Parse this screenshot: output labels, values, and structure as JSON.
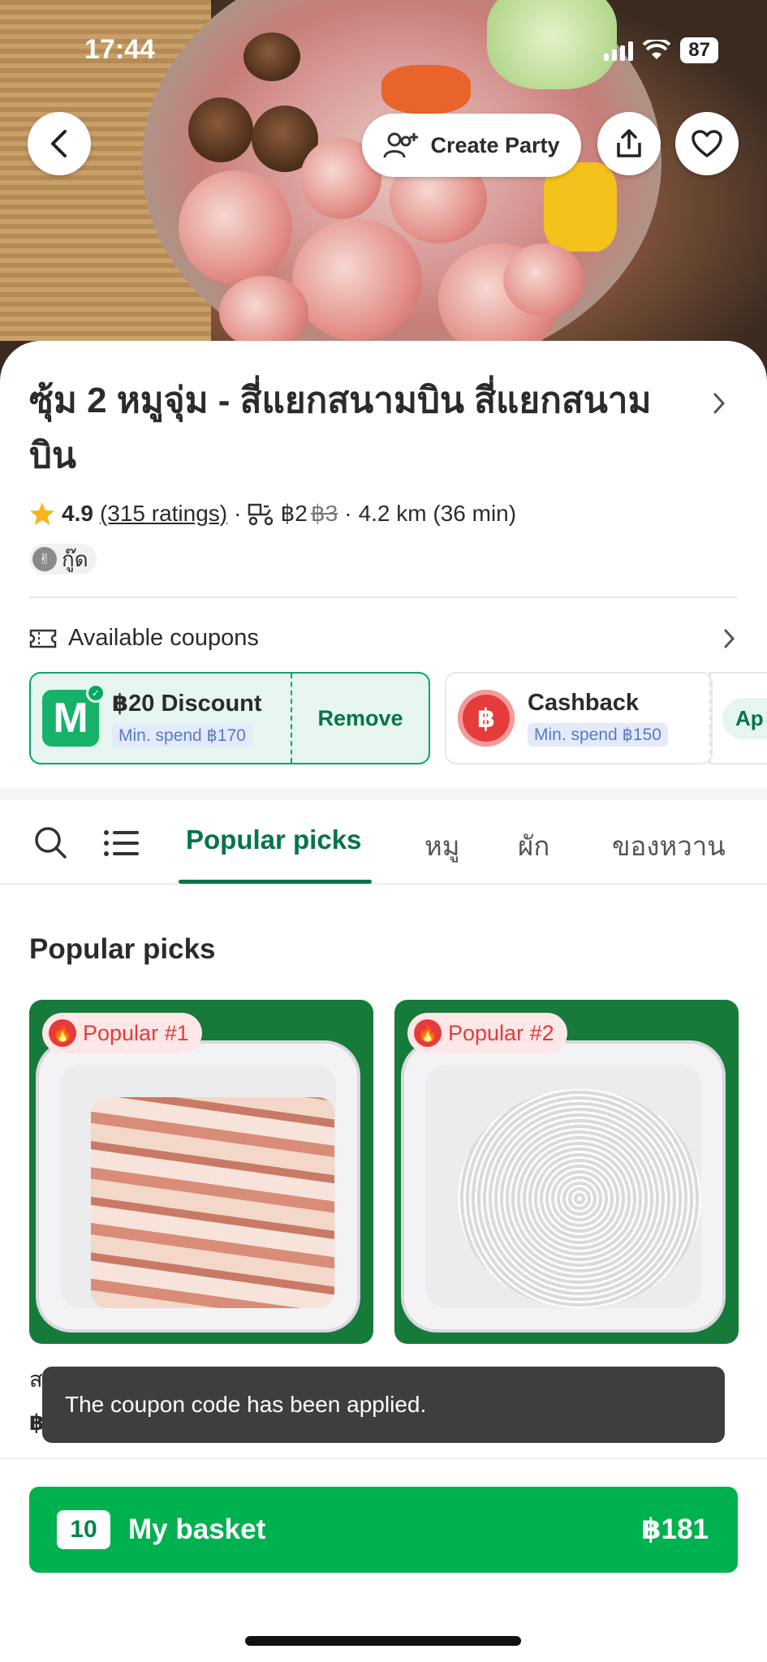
{
  "status_bar": {
    "time": "17:44",
    "battery": "87"
  },
  "hero": {
    "create_party_label": "Create Party"
  },
  "restaurant": {
    "name": "ซุ้ม 2 หมูจุ่ม - สี่แยกสนามบิน สี่แยกสนามบิน",
    "rating": "4.9",
    "ratings_count": "(315 ratings)",
    "delivery_fee": "฿2",
    "delivery_fee_original": "฿3",
    "distance_time": "4.2 km (36 min)",
    "tag": "กู๊ด"
  },
  "coupons": {
    "header": "Available coupons",
    "items": [
      {
        "title": "฿20 Discount",
        "min_spend": "Min. spend ฿170",
        "action": "Remove",
        "applied": true
      },
      {
        "title": "Cashback",
        "min_spend": "Min. spend ฿150",
        "action": "Ap",
        "applied": false
      }
    ]
  },
  "tabs": {
    "items": [
      {
        "label": "Popular picks",
        "active": true
      },
      {
        "label": "หมู",
        "active": false
      },
      {
        "label": "ผัก",
        "active": false
      },
      {
        "label": "ของหวาน",
        "active": false
      }
    ]
  },
  "section": {
    "title": "Popular picks",
    "items": [
      {
        "badge": "Popular #1",
        "name_partial": "ส",
        "price_partial": "฿"
      },
      {
        "badge": "Popular #2",
        "name_partial": "",
        "price_partial": ""
      }
    ]
  },
  "toast": {
    "message": "The coupon code has been applied."
  },
  "basket": {
    "count": "10",
    "label": "My basket",
    "total": "฿181"
  },
  "colors": {
    "primary": "#00b14f",
    "accent_text": "#00754a",
    "popular": "#e53b3b",
    "toast_bg": "#3e3e3e"
  }
}
